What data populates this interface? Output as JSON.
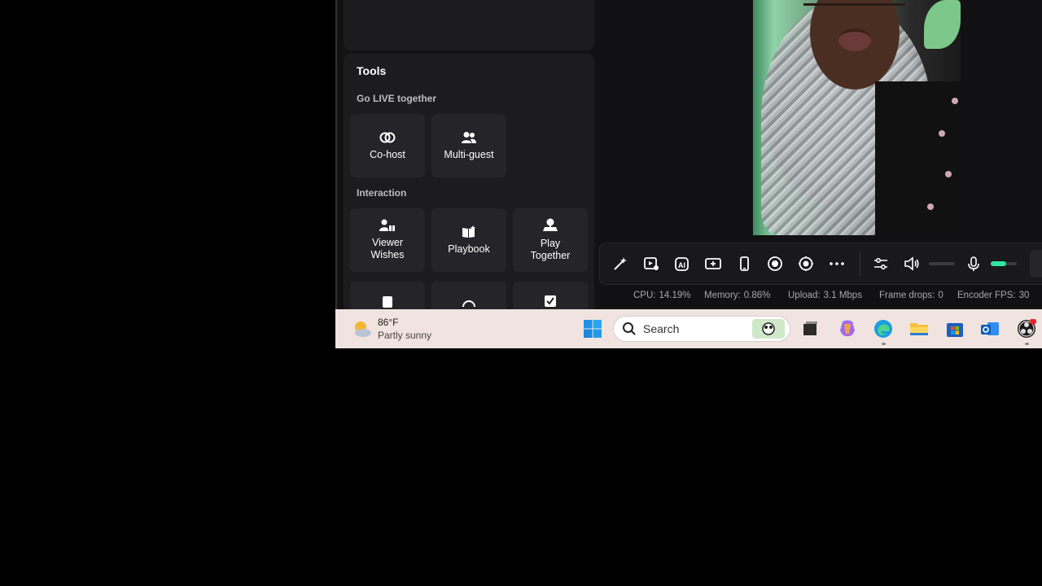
{
  "tools": {
    "title": "Tools",
    "go_live": {
      "label": "Go LIVE together",
      "tiles": [
        {
          "label": "Co-host",
          "icon": "link-icon"
        },
        {
          "label": "Multi-guest",
          "icon": "users-icon"
        }
      ]
    },
    "interaction": {
      "label": "Interaction",
      "tiles": [
        {
          "label": "Viewer\nWishes",
          "icon": "gift-user-icon"
        },
        {
          "label": "Playbook",
          "icon": "book-icon"
        },
        {
          "label": "Play\nTogether",
          "icon": "play-together-icon"
        }
      ]
    }
  },
  "controls": {
    "icons": [
      "magic-wand-icon",
      "media-icon",
      "ai-icon",
      "add-source-icon",
      "phone-icon",
      "record-icon",
      "virtual-camera-icon",
      "more-icon",
      "adjust-icon",
      "speaker-icon",
      "microphone-icon"
    ],
    "speaker_volume": 0,
    "mic_volume": 0.6,
    "accent": "#2ee6a0"
  },
  "stats": {
    "cpu_label": "CPU:",
    "cpu": "14.19%",
    "mem_label": "Memory:",
    "mem": "0.86%",
    "upload_label": "Upload:",
    "upload": "3.1 Mbps",
    "drops_label": "Frame drops:",
    "drops": "0",
    "fps_label": "Encoder FPS:",
    "fps": "30"
  },
  "taskbar": {
    "weather_temp": "86°F",
    "weather_desc": "Partly sunny",
    "search_placeholder": "Search",
    "apps": [
      "windows-start-icon",
      "task-view-icon",
      "copilot-icon",
      "edge-icon",
      "file-explorer-icon",
      "store-icon",
      "outlook-icon",
      "obs-icon"
    ]
  }
}
